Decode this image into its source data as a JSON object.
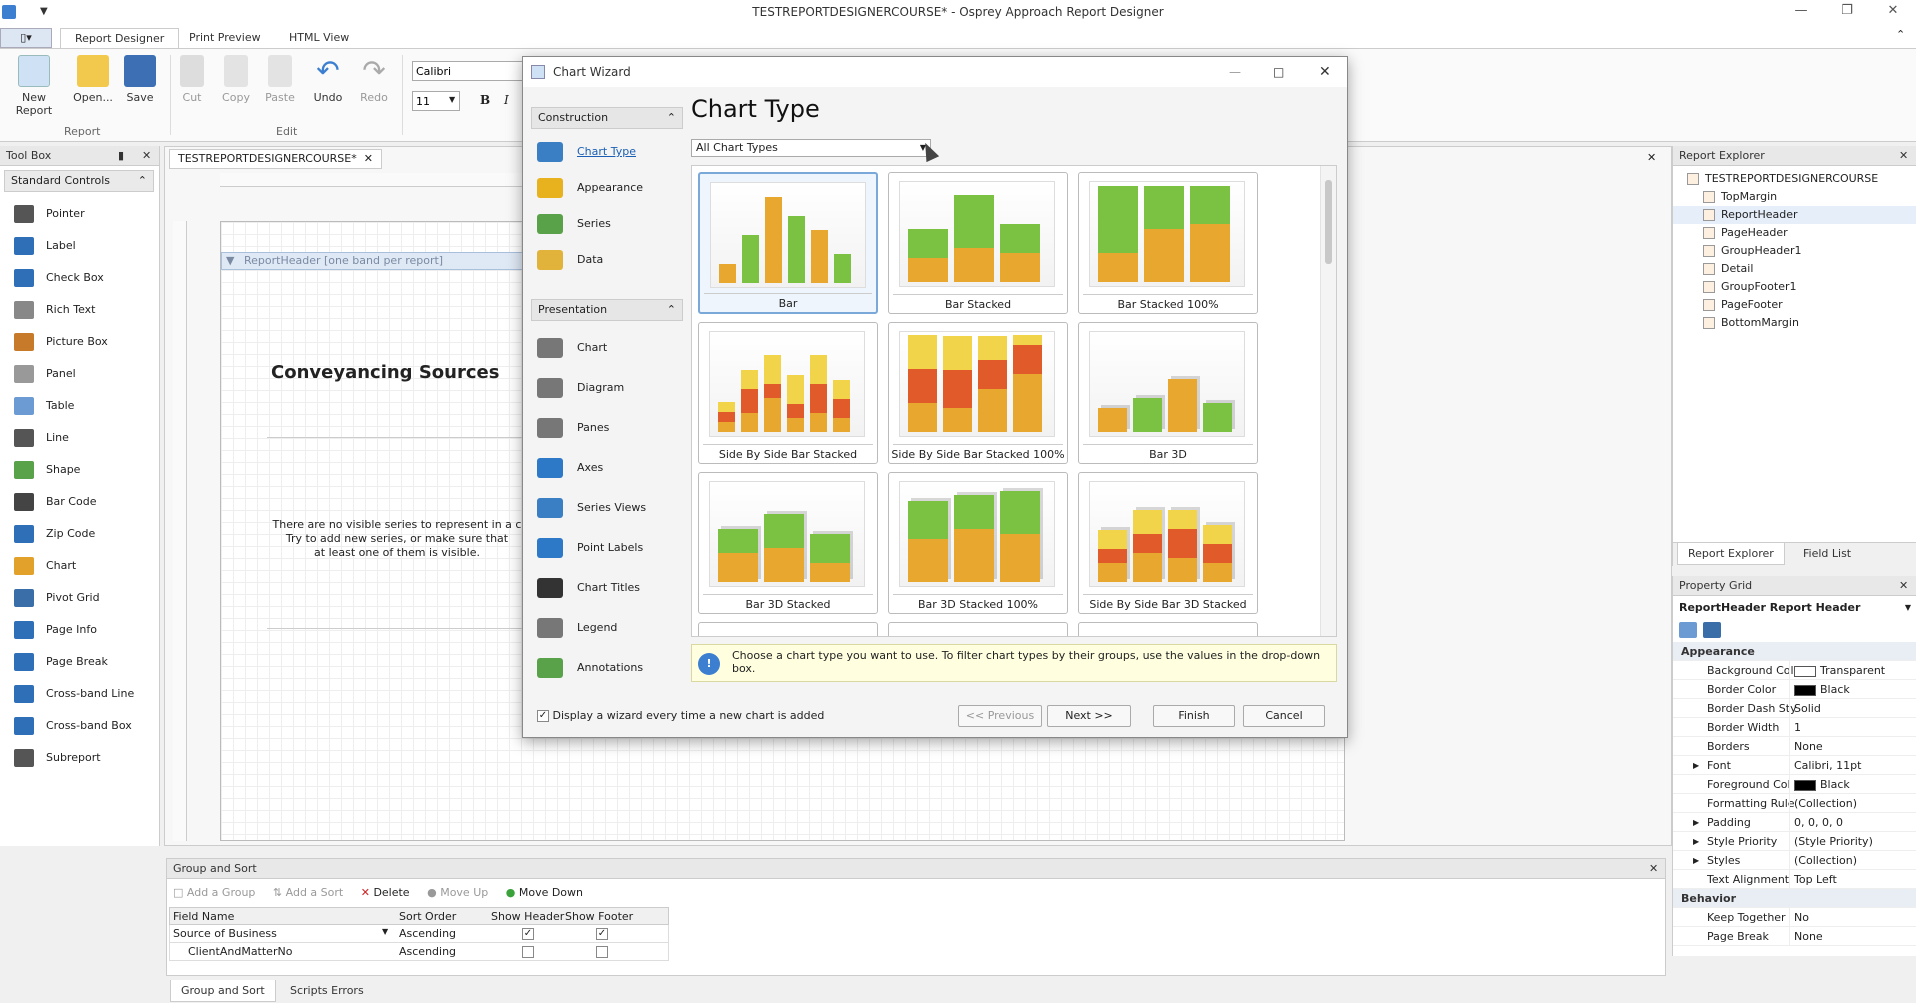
{
  "app": {
    "title": "TESTREPORTDESIGNERCOURSE* - Osprey Approach Report Designer"
  },
  "ribbon": {
    "tabs": [
      "Report Designer",
      "Print Preview",
      "HTML View"
    ],
    "buttons": [
      {
        "label": "New Report",
        "color": "#cfe2f5"
      },
      {
        "label": "Open...",
        "color": "#f2c94c"
      },
      {
        "label": "Save",
        "color": "#3c6fb3"
      },
      {
        "label": "Cut",
        "color": "#bbbbbb"
      },
      {
        "label": "Copy",
        "color": "#cccccc"
      },
      {
        "label": "Paste",
        "color": "#cccccc"
      },
      {
        "label": "Undo",
        "color": "#3c7fd0"
      },
      {
        "label": "Redo",
        "color": "#bbbbbb"
      }
    ],
    "groups": [
      "Report",
      "Edit"
    ],
    "font": {
      "name": "Calibri",
      "size": "11",
      "bold": "B",
      "italic": "I"
    }
  },
  "toolbox": {
    "title": "Tool Box",
    "category": "Standard Controls",
    "items": [
      {
        "label": "Pointer",
        "color": "#555555"
      },
      {
        "label": "Label",
        "color": "#2e6fb8"
      },
      {
        "label": "Check Box",
        "color": "#2e6fb8"
      },
      {
        "label": "Rich Text",
        "color": "#888888"
      },
      {
        "label": "Picture Box",
        "color": "#c77b2a"
      },
      {
        "label": "Panel",
        "color": "#999999"
      },
      {
        "label": "Table",
        "color": "#6b9bd2"
      },
      {
        "label": "Line",
        "color": "#555555"
      },
      {
        "label": "Shape",
        "color": "#5aa24a"
      },
      {
        "label": "Bar Code",
        "color": "#444444"
      },
      {
        "label": "Zip Code",
        "color": "#2e6fb8"
      },
      {
        "label": "Chart",
        "color": "#e2a12a"
      },
      {
        "label": "Pivot Grid",
        "color": "#3a6ea8"
      },
      {
        "label": "Page Info",
        "color": "#2e6fb8"
      },
      {
        "label": "Page Break",
        "color": "#2e6fb8"
      },
      {
        "label": "Cross-band Line",
        "color": "#2e6fb8"
      },
      {
        "label": "Cross-band Box",
        "color": "#2e6fb8"
      },
      {
        "label": "Subreport",
        "color": "#555555"
      }
    ]
  },
  "designer": {
    "tab": "TESTREPORTDESIGNERCOURSE*",
    "band": "ReportHeader [one band per report]",
    "report_title": "Conveyancing Sources",
    "chart_msg": [
      "There are no visible series to represent in a c",
      "Try to add new series, or make sure that",
      "at least one of them is visible."
    ]
  },
  "explorer": {
    "title": "Report Explorer",
    "root": "TESTREPORTDESIGNERCOURSE",
    "items": [
      "TopMargin",
      "ReportHeader",
      "PageHeader",
      "GroupHeader1",
      "Detail",
      "GroupFooter1",
      "PageFooter",
      "BottomMargin"
    ],
    "tabs": [
      "Report Explorer",
      "Field List"
    ]
  },
  "propgrid": {
    "title": "Property Grid",
    "object": "ReportHeader  Report Header",
    "rows": [
      {
        "cat": "Appearance"
      },
      {
        "n": "Background Col",
        "v": "Transparent",
        "sw": "#ffffff"
      },
      {
        "n": "Border Color",
        "v": "Black",
        "sw": "#000000"
      },
      {
        "n": "Border Dash Sty",
        "v": "Solid"
      },
      {
        "n": "Border Width",
        "v": "1"
      },
      {
        "n": "Borders",
        "v": "None"
      },
      {
        "n": "Font",
        "v": "Calibri, 11pt",
        "exp": true
      },
      {
        "n": "Foreground Col",
        "v": "Black",
        "sw": "#000000"
      },
      {
        "n": "Formatting Rule",
        "v": "(Collection)"
      },
      {
        "n": "Padding",
        "v": "0, 0, 0, 0",
        "exp": true
      },
      {
        "n": "Style Priority",
        "v": "(Style Priority)",
        "exp": true
      },
      {
        "n": "Styles",
        "v": "(Collection)",
        "exp": true
      },
      {
        "n": "Text Alignment",
        "v": "Top Left"
      },
      {
        "cat": "Behavior"
      },
      {
        "n": "Keep Together",
        "v": "No"
      },
      {
        "n": "Page Break",
        "v": "None"
      }
    ]
  },
  "groupsort": {
    "title": "Group and Sort",
    "toolbar": [
      "Add a Group",
      "Add a Sort",
      "Delete",
      "Move Up",
      "Move Down"
    ],
    "headers": [
      "Field Name",
      "Sort Order",
      "Show Header",
      "Show Footer"
    ],
    "rows": [
      {
        "field": "Source of Business",
        "order": "Ascending",
        "hdr": true,
        "ftr": true
      },
      {
        "field": "ClientAndMatterNo",
        "order": "Ascending",
        "hdr": false,
        "ftr": false
      }
    ],
    "tabs": [
      "Group and Sort",
      "Scripts Errors"
    ]
  },
  "wizard": {
    "title": "Chart Wizard",
    "construction": "Construction",
    "presentation": "Presentation",
    "nav_construction": [
      {
        "label": "Chart Type",
        "color": "#3a7fc4"
      },
      {
        "label": "Appearance",
        "color": "#e8b21e"
      },
      {
        "label": "Series",
        "color": "#5aa24a"
      },
      {
        "label": "Data",
        "color": "#e2b33a"
      }
    ],
    "nav_presentation": [
      {
        "label": "Chart",
        "color": "#777777"
      },
      {
        "label": "Diagram",
        "color": "#777777"
      },
      {
        "label": "Panes",
        "color": "#777777"
      },
      {
        "label": "Axes",
        "color": "#2e78c8"
      },
      {
        "label": "Series Views",
        "color": "#3a7fc4"
      },
      {
        "label": "Point Labels",
        "color": "#2e78c8"
      },
      {
        "label": "Chart Titles",
        "color": "#333333"
      },
      {
        "label": "Legend",
        "color": "#777777"
      },
      {
        "label": "Annotations",
        "color": "#5aa24a"
      }
    ],
    "heading": "Chart Type",
    "filter": "All Chart Types",
    "tiles": [
      "Bar",
      "Bar Stacked",
      "Bar Stacked 100%",
      "Side By Side Bar Stacked",
      "Side By Side Bar Stacked 100%",
      "Bar 3D",
      "Bar 3D Stacked",
      "Bar 3D Stacked 100%",
      "Side By Side Bar 3D Stacked"
    ],
    "info": "Choose a chart type you want to use. To filter chart types by their groups, use the values in the drop-down box.",
    "checkbox": "Display a wizard every time a new chart is added",
    "buttons": {
      "prev": "<< Previous",
      "next": "Next >>",
      "finish": "Finish",
      "cancel": "Cancel"
    }
  }
}
